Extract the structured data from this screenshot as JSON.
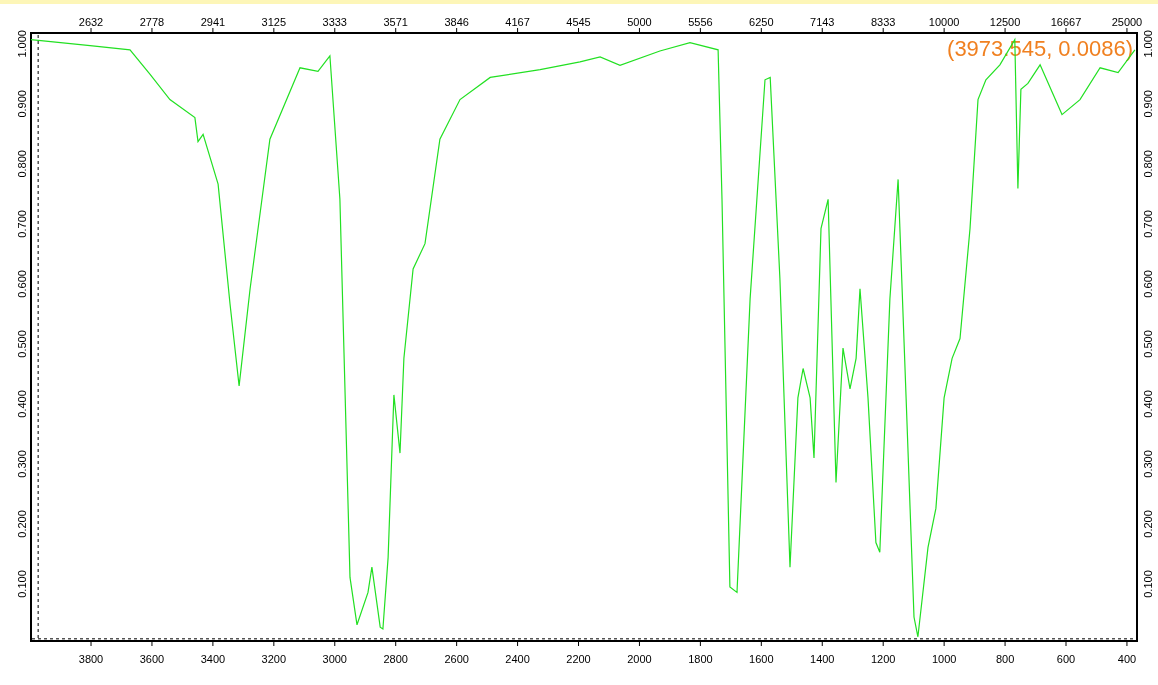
{
  "spectrum_plot": {
    "chart_data": {
      "type": "line",
      "x": [
        3997,
        3803,
        3672,
        3606,
        3541,
        3459,
        3449,
        3432,
        3383,
        3344,
        3314,
        3278,
        3213,
        3114,
        3055,
        3016,
        2983,
        2950,
        2927,
        2891,
        2878,
        2851,
        2842,
        2825,
        2806,
        2786,
        2773,
        2743,
        2704,
        2655,
        2589,
        2490,
        2326,
        2195,
        2129,
        2064,
        1933,
        1834,
        1742,
        1729,
        1703,
        1680,
        1637,
        1588,
        1571,
        1539,
        1506,
        1480,
        1463,
        1440,
        1427,
        1404,
        1381,
        1355,
        1332,
        1309,
        1289,
        1276,
        1250,
        1224,
        1211,
        1178,
        1151,
        1125,
        1099,
        1086,
        1053,
        1027,
        1000,
        974,
        948,
        915,
        889,
        863,
        817,
        768,
        758,
        748,
        725,
        685,
        613,
        554,
        488,
        429,
        374
      ],
      "series": [
        {
          "color": "#22e022",
          "values": [
            1.007,
            0.997,
            0.99,
            0.949,
            0.907,
            0.877,
            0.837,
            0.849,
            0.766,
            0.567,
            0.43,
            0.592,
            0.841,
            0.96,
            0.954,
            0.98,
            0.741,
            0.111,
            0.032,
            0.086,
            0.128,
            0.028,
            0.025,
            0.144,
            0.415,
            0.318,
            0.476,
            0.625,
            0.667,
            0.841,
            0.907,
            0.944,
            0.957,
            0.97,
            0.978,
            0.964,
            0.988,
            1.002,
            0.99,
            0.741,
            0.095,
            0.086,
            0.575,
            0.94,
            0.944,
            0.609,
            0.128,
            0.41,
            0.459,
            0.41,
            0.31,
            0.692,
            0.741,
            0.269,
            0.493,
            0.425,
            0.476,
            0.592,
            0.41,
            0.169,
            0.153,
            0.575,
            0.774,
            0.41,
            0.045,
            0.012,
            0.161,
            0.226,
            0.41,
            0.476,
            0.509,
            0.692,
            0.907,
            0.94,
            0.965,
            1.007,
            0.759,
            0.924,
            0.934,
            0.965,
            0.882,
            0.907,
            0.96,
            0.952,
            0.99
          ]
        }
      ],
      "xlim": [
        3997,
        367
      ],
      "ylim": [
        0.005,
        1.018
      ],
      "xticks": [
        3800,
        3600,
        3400,
        3200,
        3000,
        2800,
        2600,
        2400,
        2200,
        2000,
        1800,
        1600,
        1400,
        1200,
        1000,
        800,
        600,
        400
      ],
      "yticks": [
        {
          "value": 0.1,
          "label": "0.100"
        },
        {
          "value": 0.2,
          "label": "0.200"
        },
        {
          "value": 0.3,
          "label": "0.300"
        },
        {
          "value": 0.4,
          "label": "0.400"
        },
        {
          "value": 0.5,
          "label": "0.500"
        },
        {
          "value": 0.6,
          "label": "0.600"
        },
        {
          "value": 0.7,
          "label": "0.700"
        },
        {
          "value": 0.8,
          "label": "0.800"
        },
        {
          "value": 0.9,
          "label": "0.900"
        },
        {
          "value": 1.0,
          "label": "1.000"
        }
      ],
      "ref_lines": [
        {
          "axis": "x",
          "value": 3973.545
        },
        {
          "axis": "y",
          "value": 0.0086
        }
      ],
      "annotations": [
        "(3973.545, 0.0086)"
      ]
    },
    "top_axis": {
      "labels": [
        "2632",
        "2778",
        "2941",
        "3125",
        "3333",
        "3571",
        "3846",
        "4167",
        "4545",
        "5000",
        "5556",
        "6250",
        "7143",
        "8333",
        "10000",
        "12500",
        "16667",
        "25000"
      ]
    },
    "right_axis": {
      "labels": [
        "0.100",
        "0.200",
        "0.300",
        "0.400",
        "0.500",
        "0.600",
        "0.700",
        "0.800",
        "0.900",
        "1.000"
      ]
    }
  }
}
